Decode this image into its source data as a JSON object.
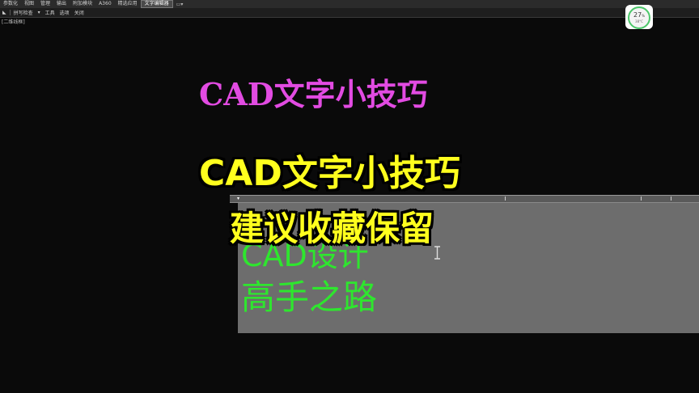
{
  "ribbon": {
    "tabs": [
      "参数化",
      "视图",
      "管理",
      "输出",
      "附加模块",
      "A360",
      "精选应用",
      "文字编辑器"
    ],
    "active_tab": "文字编辑器",
    "panel_items": [
      "拼写检查",
      "工具",
      "选项",
      "关闭"
    ]
  },
  "viewport": {
    "label": "[二维线框]"
  },
  "performance": {
    "percent": "27",
    "percent_unit": "%",
    "temp": "38°C"
  },
  "canvas": {
    "magenta_text": "CAD文字小技巧",
    "editor_line1": "CAD设计",
    "editor_line2": "高手之路"
  },
  "captions": {
    "line1": "CAD文字小技巧",
    "line2": "建议收藏保留"
  },
  "colors": {
    "magenta": "#e24be2",
    "green": "#2ee62e",
    "caption_yellow": "#ffff1e",
    "background": "#0a0a0a"
  }
}
